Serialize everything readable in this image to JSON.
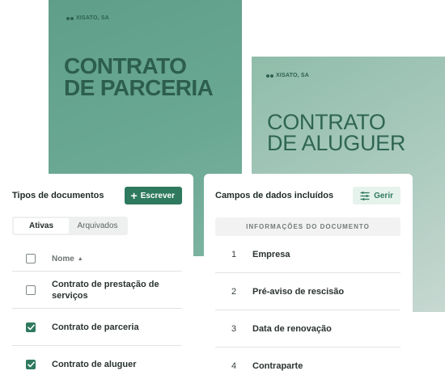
{
  "covers": [
    {
      "brand": "XISATO, SA",
      "title_lines": [
        "CONTRATO",
        "DE PARCERIA"
      ]
    },
    {
      "brand": "XISATO, SA",
      "title_lines": [
        "CONTRATO",
        "DE ALUGUER"
      ]
    }
  ],
  "doc_types": {
    "title": "Tipos de documentos",
    "write_button": "Escrever",
    "tabs": [
      {
        "label": "Ativas",
        "active": true
      },
      {
        "label": "Arquivados",
        "active": false
      }
    ],
    "column_header": "Nome",
    "items": [
      {
        "label": "Contrato de prestação de serviços",
        "checked": false
      },
      {
        "label": "Contrato de parceria",
        "checked": true
      },
      {
        "label": "Contrato de aluguer",
        "checked": true
      }
    ]
  },
  "data_fields": {
    "title": "Campos de dados incluídos",
    "manage_button": "Gerir",
    "section": "INFORMAÇÕES DO DOCUMENTO",
    "fields": [
      {
        "num": "1",
        "label": "Empresa"
      },
      {
        "num": "2",
        "label": "Pré-aviso de rescisão"
      },
      {
        "num": "3",
        "label": "Data de renovação"
      },
      {
        "num": "4",
        "label": "Contraparte"
      }
    ]
  },
  "colors": {
    "accent": "#2f7a5f",
    "cover_1": "#6aa893",
    "cover_2": "#a6c8bb"
  }
}
